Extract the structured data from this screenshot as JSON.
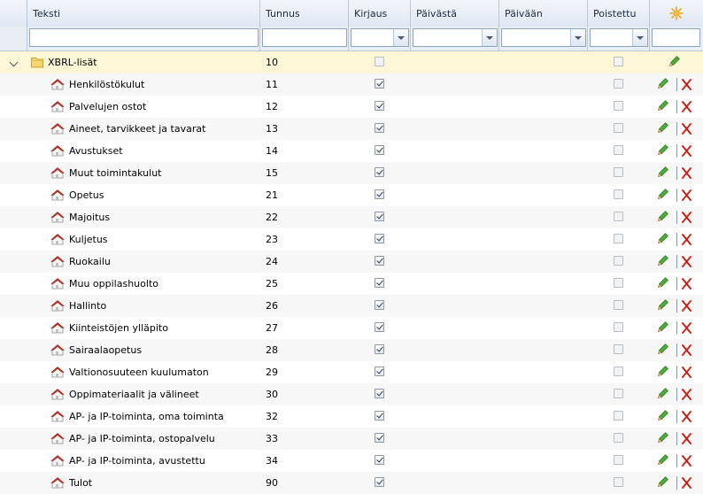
{
  "columns": {
    "teksti": "Teksti",
    "tunnus": "Tunnus",
    "kirjaus": "Kirjaus",
    "paivasta": "Päivästä",
    "paivaan": "Päivään",
    "poistettu": "Poistettu",
    "new_icon": "sun-icon"
  },
  "filters": {
    "teksti": "",
    "tunnus": "",
    "kirjaus": "",
    "paivasta": "",
    "paivaan": "",
    "poistettu": "",
    "extra": ""
  },
  "group": {
    "label": "XBRL-lisät",
    "code": "10",
    "kirjaus": false,
    "poistettu": false,
    "icon": "folder-icon"
  },
  "rows": [
    {
      "label": "Henkilöstökulut",
      "code": "11",
      "kirjaus": true,
      "poistettu": false
    },
    {
      "label": "Palvelujen ostot",
      "code": "12",
      "kirjaus": true,
      "poistettu": false
    },
    {
      "label": "Aineet, tarvikkeet ja tavarat",
      "code": "13",
      "kirjaus": true,
      "poistettu": false
    },
    {
      "label": "Avustukset",
      "code": "14",
      "kirjaus": true,
      "poistettu": false
    },
    {
      "label": "Muut toimintakulut",
      "code": "15",
      "kirjaus": true,
      "poistettu": false
    },
    {
      "label": "Opetus",
      "code": "21",
      "kirjaus": true,
      "poistettu": false
    },
    {
      "label": "Majoitus",
      "code": "22",
      "kirjaus": true,
      "poistettu": false
    },
    {
      "label": "Kuljetus",
      "code": "23",
      "kirjaus": true,
      "poistettu": false
    },
    {
      "label": "Ruokailu",
      "code": "24",
      "kirjaus": true,
      "poistettu": false
    },
    {
      "label": "Muu oppilashuolto",
      "code": "25",
      "kirjaus": true,
      "poistettu": false
    },
    {
      "label": "Hallinto",
      "code": "26",
      "kirjaus": true,
      "poistettu": false
    },
    {
      "label": "Kiinteistöjen ylläpito",
      "code": "27",
      "kirjaus": true,
      "poistettu": false
    },
    {
      "label": "Sairaalaopetus",
      "code": "28",
      "kirjaus": true,
      "poistettu": false
    },
    {
      "label": "Valtionosuuteen kuulumaton",
      "code": "29",
      "kirjaus": true,
      "poistettu": false
    },
    {
      "label": "Oppimateriaalit ja välineet",
      "code": "30",
      "kirjaus": true,
      "poistettu": false
    },
    {
      "label": "AP- ja IP-toiminta, oma toiminta",
      "code": "32",
      "kirjaus": true,
      "poistettu": false
    },
    {
      "label": "AP- ja IP-toiminta, ostopalvelu",
      "code": "33",
      "kirjaus": true,
      "poistettu": false
    },
    {
      "label": "AP- ja IP-toiminta, avustettu",
      "code": "34",
      "kirjaus": true,
      "poistettu": false
    },
    {
      "label": "Tulot",
      "code": "90",
      "kirjaus": true,
      "poistettu": false
    }
  ],
  "icons": {
    "row": "item-icon",
    "edit": "pencil-icon",
    "delete": "delete-x-icon"
  }
}
